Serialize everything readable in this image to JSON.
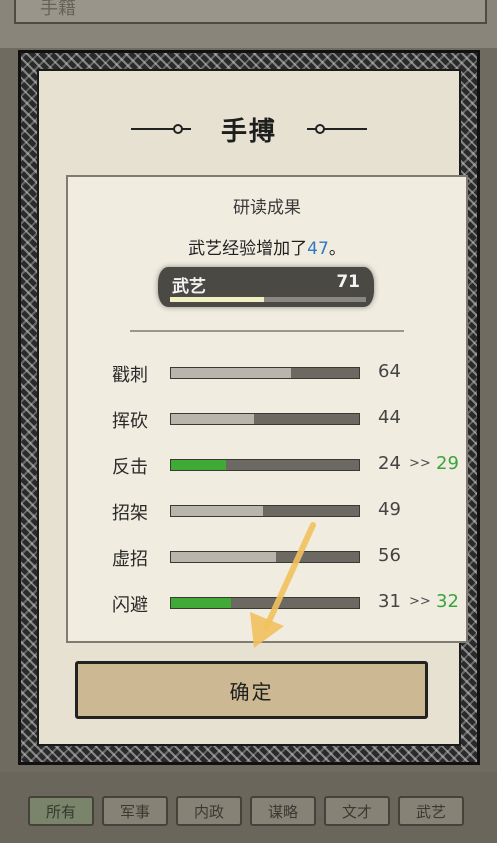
{
  "background": {
    "title": "手籍",
    "tabs": [
      "所有",
      "军事",
      "内政",
      "谋略",
      "文才",
      "武艺"
    ],
    "active_tab_index": 0
  },
  "modal": {
    "title": "手搏",
    "panel": {
      "heading": "研读成果",
      "message_prefix": "武艺经验增加了",
      "message_value": "47",
      "message_suffix": "。",
      "main_skill": {
        "name": "武艺",
        "value": "71",
        "progress": 0.48
      },
      "stats": [
        {
          "label": "戳刺",
          "value": "64",
          "fill": 0.64,
          "new": ""
        },
        {
          "label": "挥砍",
          "value": "44",
          "fill": 0.44,
          "new": ""
        },
        {
          "label": "反击",
          "value": "24",
          "fill": 0.29,
          "arrow": ">>",
          "new": "29"
        },
        {
          "label": "招架",
          "value": "49",
          "fill": 0.49,
          "new": ""
        },
        {
          "label": "虚招",
          "value": "56",
          "fill": 0.56,
          "new": ""
        },
        {
          "label": "闪避",
          "value": "31",
          "fill": 0.32,
          "arrow": ">>",
          "new": "32"
        }
      ]
    },
    "confirm_label": "确定"
  },
  "colors": {
    "increase": "#3aa33c",
    "highlight": "#2e78c6",
    "guide_arrow": "#f1c15e"
  }
}
